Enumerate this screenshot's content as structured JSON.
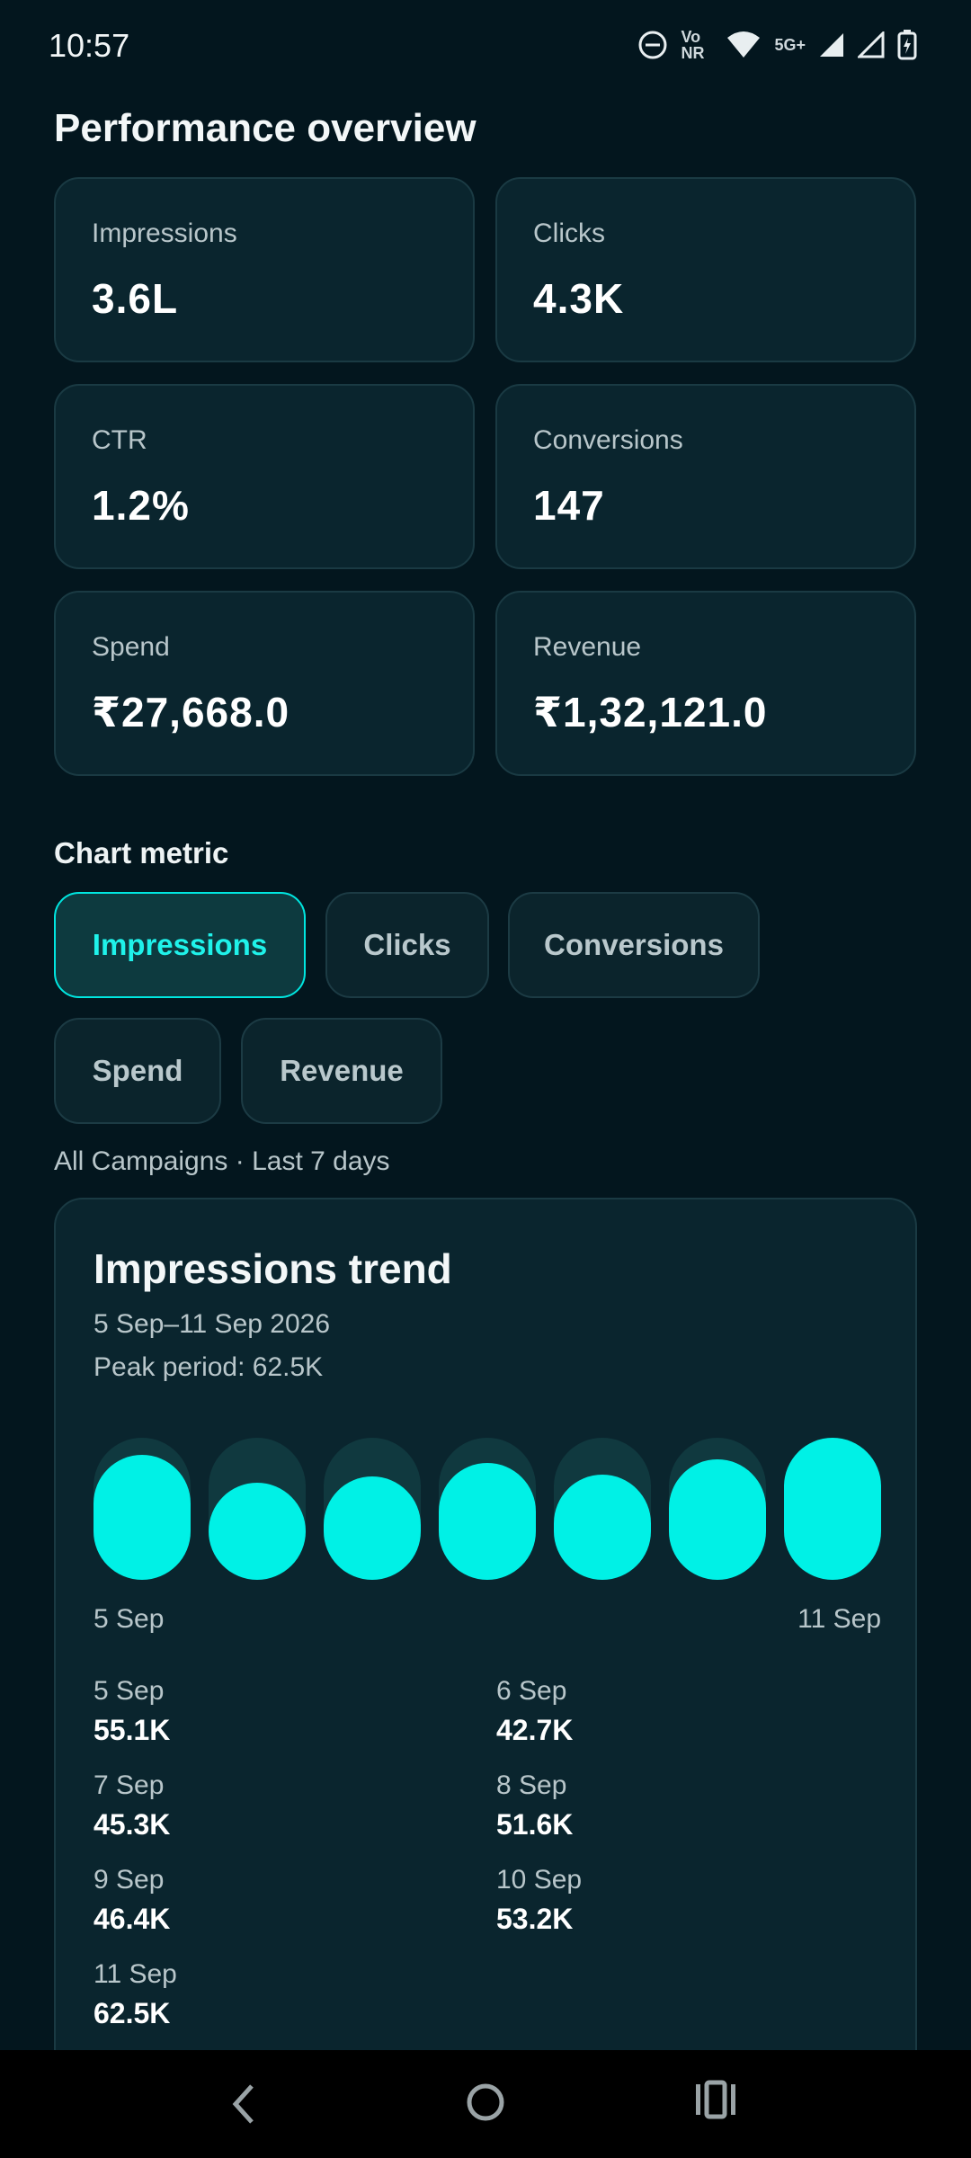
{
  "status_bar": {
    "time": "10:57",
    "icons": [
      "do-not-disturb-icon",
      "volte-icon",
      "wifi-icon",
      "5g-icon",
      "signal-icon",
      "signal-icon",
      "battery-charging-icon"
    ],
    "volte_text": "Vo NR",
    "network_text": "5G+"
  },
  "page": {
    "title": "Performance overview"
  },
  "metrics": [
    {
      "label": "Impressions",
      "value": "3.6L"
    },
    {
      "label": "Clicks",
      "value": "4.3K"
    },
    {
      "label": "CTR",
      "value": "1.2%"
    },
    {
      "label": "Conversions",
      "value": "147"
    },
    {
      "label": "Spend",
      "value": "₹27,668.0"
    },
    {
      "label": "Revenue",
      "value": "₹1,32,121.0"
    }
  ],
  "chart_metric": {
    "label": "Chart metric",
    "options": [
      "Impressions",
      "Clicks",
      "Conversions",
      "Spend",
      "Revenue"
    ],
    "selected": "Impressions"
  },
  "scope": "All Campaigns · Last 7 days",
  "trend": {
    "title": "Impressions trend",
    "range": "5 Sep–11 Sep 2026",
    "peak": "Peak period: 62.5K",
    "x_start": "5 Sep",
    "x_end": "11 Sep",
    "breakdown": [
      {
        "date": "5 Sep",
        "value": "55.1K"
      },
      {
        "date": "6 Sep",
        "value": "42.7K"
      },
      {
        "date": "7 Sep",
        "value": "45.3K"
      },
      {
        "date": "8 Sep",
        "value": "51.6K"
      },
      {
        "date": "9 Sep",
        "value": "46.4K"
      },
      {
        "date": "10 Sep",
        "value": "53.2K"
      },
      {
        "date": "11 Sep",
        "value": "62.5K"
      }
    ]
  },
  "chart_data": {
    "type": "bar",
    "categories": [
      "5 Sep",
      "6 Sep",
      "7 Sep",
      "8 Sep",
      "9 Sep",
      "10 Sep",
      "11 Sep"
    ],
    "values": [
      55.1,
      42.7,
      45.3,
      51.6,
      46.4,
      53.2,
      62.5
    ],
    "unit": "K",
    "ylim": [
      0,
      62.5
    ],
    "colors": {
      "fill": "#00f1e6",
      "track": "#10393f"
    }
  },
  "nav": {
    "icons": [
      "back-icon",
      "home-icon",
      "recents-icon"
    ]
  }
}
